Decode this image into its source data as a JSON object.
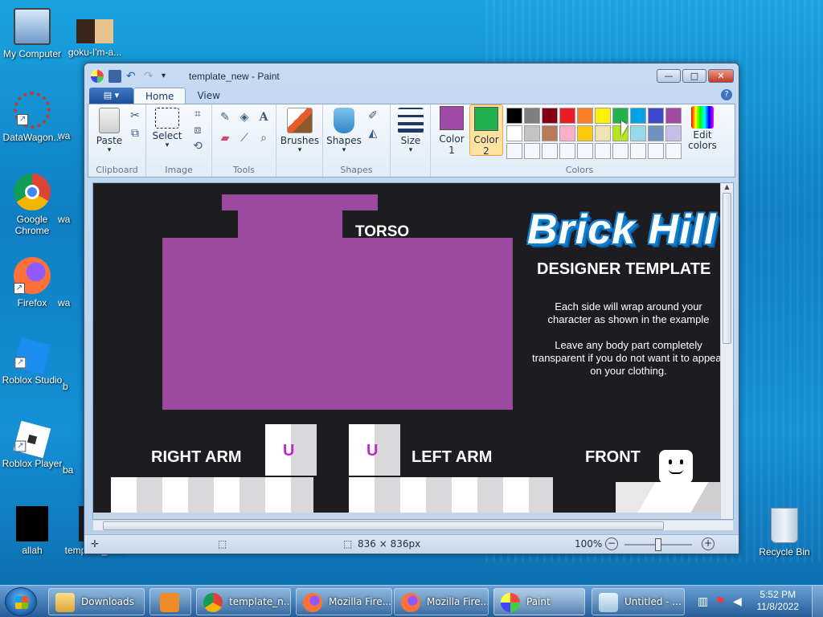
{
  "desktop": {
    "icons": [
      {
        "label": "My Computer"
      },
      {
        "label": "goku-I'm-a..."
      },
      {
        "label": "DataWagon..."
      },
      {
        "label": "Google Chrome"
      },
      {
        "label": "Firefox"
      },
      {
        "label": "Roblox Studio"
      },
      {
        "label": "Roblox Player"
      },
      {
        "label": "allah"
      },
      {
        "label": "template_new"
      },
      {
        "label": "Recycle Bin"
      }
    ],
    "partial_labels": [
      "wa",
      "wa",
      "wa",
      "b",
      "ba"
    ]
  },
  "window": {
    "title": "template_new - Paint",
    "buttons": {
      "minimize": "—",
      "maximize": "□",
      "close": "✕"
    }
  },
  "ribbon": {
    "tabs": [
      "Home",
      "View"
    ],
    "groups": {
      "clipboard": {
        "label": "Clipboard",
        "paste": "Paste"
      },
      "image": {
        "label": "Image",
        "select": "Select"
      },
      "tools": {
        "label": "Tools"
      },
      "brushes": {
        "label": "Brushes"
      },
      "shapes": {
        "label": "Shapes",
        "shapes_btn": "Shapes"
      },
      "size": {
        "label": "Size"
      },
      "colors": {
        "label": "Colors",
        "color1": "Color 1",
        "color2": "Color 2",
        "edit": "Edit colors"
      }
    },
    "color1_value": "#a04aa6",
    "color2_value": "#22b14c",
    "palette_row1": [
      "#000000",
      "#7f7f7f",
      "#880015",
      "#ed1c24",
      "#ff7f27",
      "#fff200",
      "#22b14c",
      "#00a2e8",
      "#3f48cc",
      "#a349a4"
    ],
    "palette_row2": [
      "#ffffff",
      "#c3c3c3",
      "#b97a57",
      "#ffaec9",
      "#ffc90e",
      "#efe4b0",
      "#b5e61d",
      "#99d9ea",
      "#7092be",
      "#c8bfe7"
    ]
  },
  "canvas": {
    "torso": "TORSO",
    "logo": "Brick Hill",
    "heading": "DESIGNER TEMPLATE",
    "para1": "Each side will wrap around your character as shown in the example",
    "para2": "Leave any body part completely transparent if you do not want it to appear on your clothing.",
    "right_arm": "RIGHT ARM",
    "left_arm": "LEFT ARM",
    "front": "FRONT",
    "u_label": "U"
  },
  "statusbar": {
    "dimensions": "836 × 836px",
    "zoom": "100%"
  },
  "taskbar": {
    "items": [
      "Downloads",
      "template_n...",
      "Mozilla Fire...",
      "Mozilla Fire...",
      "Paint",
      "Untitled - ..."
    ],
    "time": "5:52 PM",
    "date": "11/8/2022"
  }
}
